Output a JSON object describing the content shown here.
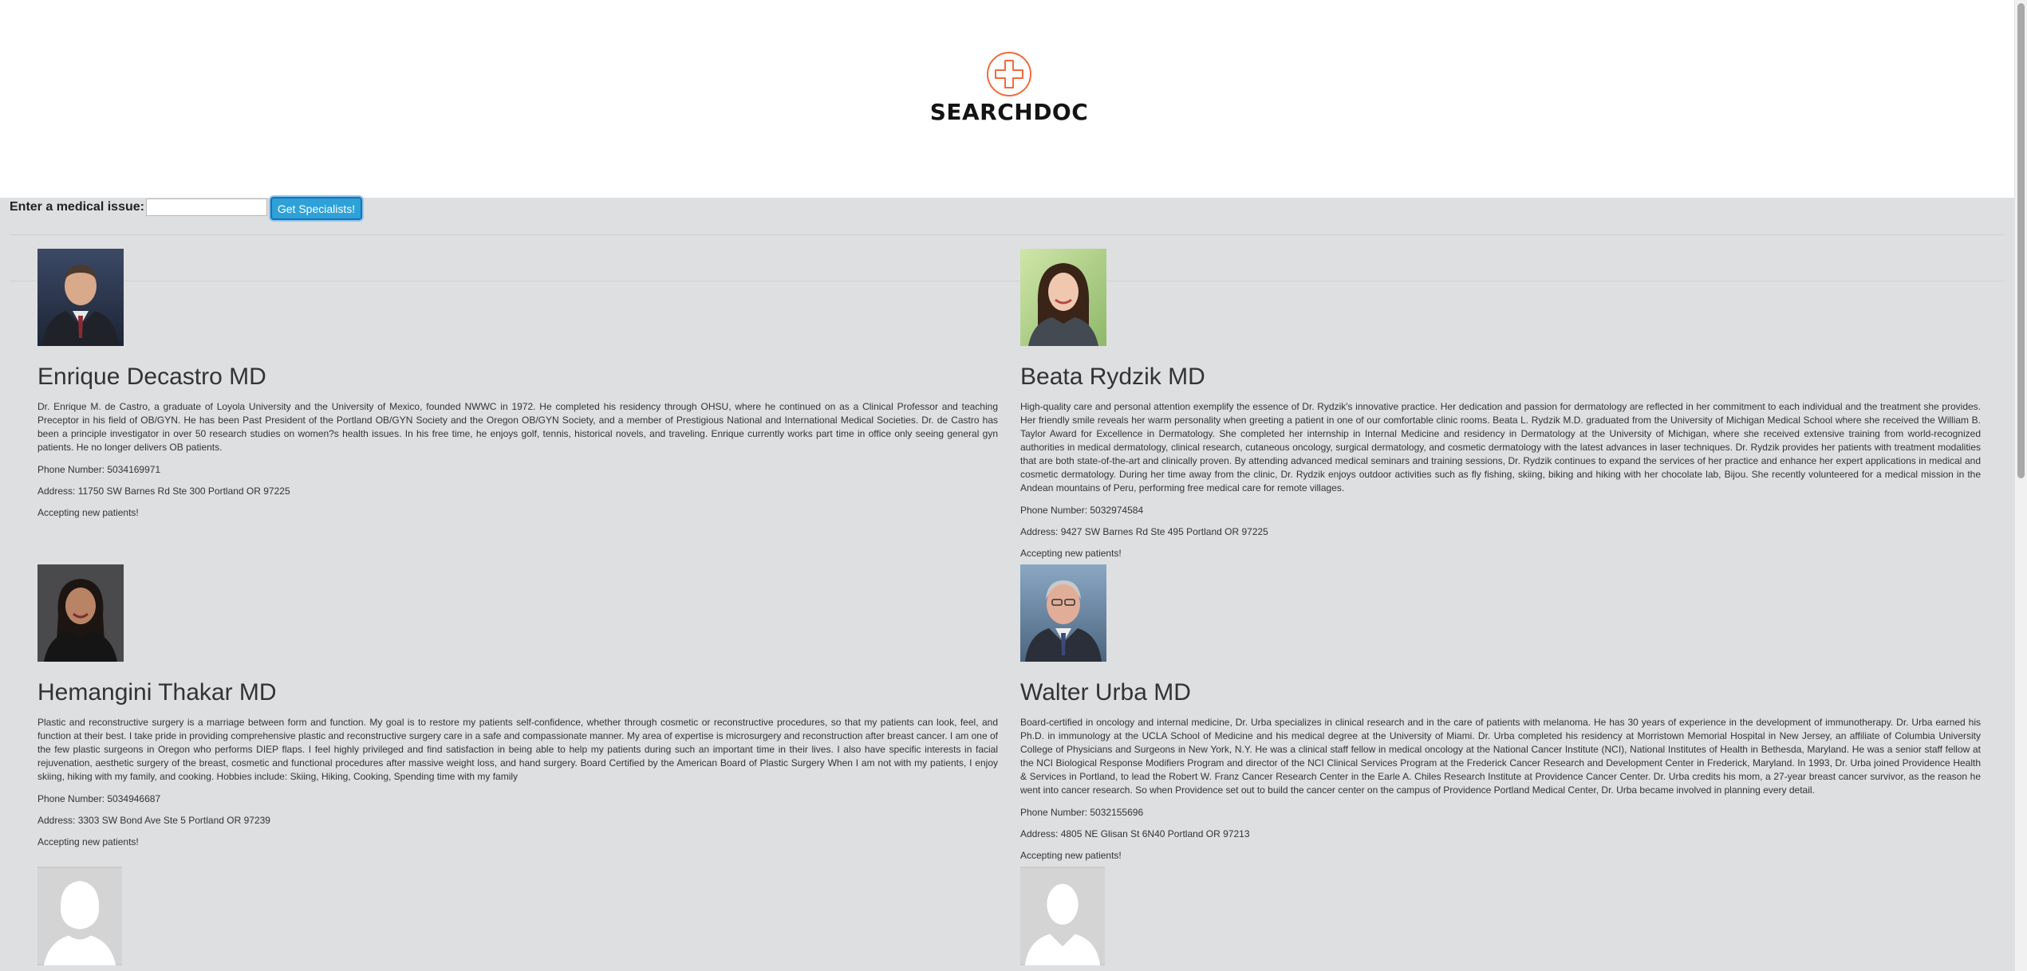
{
  "header": {
    "logo_text": "SEARCHDOC",
    "logo_icon": "medical-cross-icon",
    "brand_color": "#f26a3d"
  },
  "search": {
    "label": "Enter a medical issue:",
    "value": "",
    "placeholder": "",
    "button_label": "Get Specialists!",
    "button_color": "#2ea1d9"
  },
  "doctors": [
    {
      "name": "Enrique Decastro MD",
      "bio": "Dr. Enrique M. de Castro, a graduate of Loyola University and the University of Mexico, founded NWWC in 1972. He completed his residency through OHSU, where he continued on as a Clinical Professor and teaching Preceptor in his field of OB/GYN. He has been Past President of the Portland OB/GYN Society and the Oregon OB/GYN Society, and a member of Prestigious National and International Medical Societies. Dr. de Castro has been a principle investigator in over 50 research studies on women?s health issues. In his free time, he enjoys golf, tennis, historical novels, and traveling. Enrique currently works part time in office only seeing general gyn patients. He no longer delivers OB patients.",
      "phone": "Phone Number: 5034169971",
      "address": "Address: 11750 SW Barnes Rd Ste 300 Portland OR 97225",
      "accepting": "Accepting new patients!",
      "photo": "man-portrait"
    },
    {
      "name": "Beata Rydzik MD",
      "bio": "High-quality care and personal attention exemplify the essence of Dr. Rydzik's innovative practice. Her dedication and passion for dermatology are reflected in her commitment to each individual and the treatment she provides. Her friendly smile reveals her warm personality when greeting a patient in one of our comfortable clinic rooms. Beata L. Rydzik M.D. graduated from the University of Michigan Medical School where she received the William B. Taylor Award for Excellence in Dermatology. She completed her internship in Internal Medicine and residency in Dermatology at the University of Michigan, where she received extensive training from world-recognized authorities in medical dermatology, clinical research, cutaneous oncology, surgical dermatology, and cosmetic dermatology with the latest advances in laser techniques. Dr. Rydzik provides her patients with treatment modalities that are both state-of-the-art and clinically proven. By attending advanced medical seminars and training sessions, Dr. Rydzik continues to expand the services of her practice and enhance her expert applications in medical and cosmetic dermatology. During her time away from the clinic, Dr. Rydzik enjoys outdoor activities such as fly fishing, skiing, biking and hiking with her chocolate lab, Bijou. She recently volunteered for a medical mission in the Andean mountains of Peru, performing free medical care for remote villages.",
      "phone": "Phone Number: 5032974584",
      "address": "Address: 9427 SW Barnes Rd Ste 495 Portland OR 97225",
      "accepting": "Accepting new patients!",
      "photo": "woman-portrait"
    },
    {
      "name": "Hemangini Thakar MD",
      "bio": "Plastic and reconstructive surgery is a marriage between form and function. My goal is to restore my patients self-confidence, whether through cosmetic or reconstructive procedures, so that my patients can look, feel, and function at their best. I take pride in providing comprehensive plastic and reconstructive surgery care in a safe and compassionate manner. My area of expertise is microsurgery and reconstruction after breast cancer. I am one of the few plastic surgeons in Oregon who performs DIEP flaps. I feel highly privileged and find satisfaction in being able to help my patients during such an important time in their lives. I also have specific interests in facial rejuvenation, aesthetic surgery of the breast, cosmetic and functional procedures after massive weight loss, and hand surgery. Board Certified by the American Board of Plastic Surgery When I am not with my patients, I enjoy skiing, hiking with my family, and cooking. Hobbies include: Skiing, Hiking, Cooking, Spending time with my family",
      "phone": "Phone Number: 5034946687",
      "address": "Address: 3303 SW Bond Ave Ste 5 Portland OR 97239",
      "accepting": "Accepting new patients!",
      "photo": "woman-portrait"
    },
    {
      "name": "Walter Urba MD",
      "bio": "Board-certified in oncology and internal medicine, Dr. Urba specializes in clinical research and in the care of patients with melanoma. He has 30 years of experience in the development of immunotherapy. Dr. Urba earned his Ph.D. in immunology at the UCLA School of Medicine and his medical degree at the University of Miami. Dr. Urba completed his residency at Morristown Memorial Hospital in New Jersey, an affiliate of Columbia University College of Physicians and Surgeons in New York, N.Y. He was a clinical staff fellow in medical oncology at the National Cancer Institute (NCI), National Institutes of Health in Bethesda, Maryland. He was a senior staff fellow at the NCI Biological Response Modifiers Program and director of the NCI Clinical Services Program at the Frederick Cancer Research and Development Center in Frederick, Maryland. In 1993, Dr. Urba joined Providence Health & Services in Portland, to lead the Robert W. Franz Cancer Research Center in the Earle A. Chiles Research Institute at Providence Cancer Center. Dr. Urba credits his mom, a 27-year breast cancer survivor, as the reason he went into cancer research. So when Providence set out to build the cancer center on the campus of Providence Portland Medical Center, Dr. Urba became involved in planning every detail.",
      "phone": "Phone Number: 5032155696",
      "address": "Address: 4805 NE Glisan St 6N40 Portland OR 97213",
      "accepting": "Accepting new patients!",
      "photo": "man-portrait"
    },
    {
      "photo": "female-placeholder-avatar"
    },
    {
      "photo": "male-placeholder-avatar"
    }
  ]
}
